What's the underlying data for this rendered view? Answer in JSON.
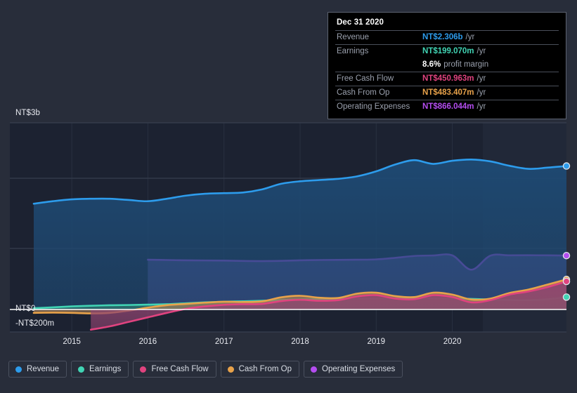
{
  "chart_data": {
    "type": "area",
    "title": "",
    "xlabel": "",
    "ylabel": "",
    "currency": "NT$",
    "grid": true,
    "legend_position": "bottom",
    "x_ticks": [
      "2015",
      "2016",
      "2017",
      "2018",
      "2019",
      "2020"
    ],
    "y_ticks": [
      "NT$3b",
      "NT$0",
      "-NT$200m"
    ],
    "ylim": [
      -200000000,
      3400000000
    ],
    "zero_line": 0,
    "series": [
      {
        "name": "Revenue",
        "color": "#2d9cec",
        "fill": "#1e4a74",
        "values": [
          1.7,
          1.74,
          1.77,
          1.78,
          1.78,
          1.76,
          1.74,
          1.78,
          1.83,
          1.86,
          1.87,
          1.88,
          1.93,
          2.02,
          2.06,
          2.08,
          2.1,
          2.14,
          2.22,
          2.33,
          2.4,
          2.34,
          2.39,
          2.41,
          2.38,
          2.31,
          2.26,
          2.28,
          2.306
        ],
        "unit": "NT$b"
      },
      {
        "name": "Earnings",
        "color": "#41d4b4",
        "fill": "#2f7f74",
        "values": [
          0.02,
          0.035,
          0.05,
          0.06,
          0.068,
          0.072,
          0.078,
          0.085,
          0.1,
          0.115,
          0.125,
          0.132,
          0.14,
          0.152,
          0.16,
          0.165,
          0.17,
          0.172,
          0.175,
          0.178,
          0.18,
          0.178,
          0.175,
          0.17,
          0.16,
          0.152,
          0.15,
          0.165,
          0.199
        ],
        "unit": "NT$b"
      },
      {
        "name": "Free Cash Flow",
        "color": "#e0437f",
        "fill": "#8e4470",
        "values": [
          null,
          null,
          null,
          -0.18,
          -0.15,
          -0.11,
          -0.07,
          -0.03,
          0.01,
          0.05,
          0.075,
          0.085,
          0.09,
          0.135,
          0.155,
          0.14,
          0.15,
          0.21,
          0.23,
          0.175,
          0.165,
          0.23,
          0.2,
          0.115,
          0.15,
          0.24,
          0.29,
          0.36,
          0.451
        ],
        "unit": "NT$b"
      },
      {
        "name": "Cash From Op",
        "color": "#e8a24a",
        "fill": "#a07a53",
        "values": [
          -0.03,
          -0.028,
          -0.03,
          -0.035,
          -0.03,
          -0.01,
          0.03,
          0.07,
          0.09,
          0.11,
          0.125,
          0.12,
          0.13,
          0.195,
          0.22,
          0.19,
          0.185,
          0.255,
          0.27,
          0.215,
          0.2,
          0.27,
          0.24,
          0.16,
          0.175,
          0.265,
          0.32,
          0.4,
          0.483
        ],
        "unit": "NT$b"
      },
      {
        "name": "Operating Expenses",
        "color": "#b44df0",
        "fill": "#564a8e",
        "values": [
          null,
          null,
          null,
          null,
          null,
          null,
          0.8,
          0.795,
          0.79,
          0.788,
          0.786,
          0.78,
          0.778,
          0.782,
          0.79,
          0.795,
          0.797,
          0.8,
          0.805,
          0.83,
          0.86,
          0.868,
          0.87,
          0.64,
          0.865,
          0.87,
          0.872,
          0.87,
          0.866
        ],
        "unit": "NT$b"
      }
    ]
  },
  "tooltip": {
    "date": "Dec 31 2020",
    "rows": [
      {
        "label": "Revenue",
        "value": "NT$2.306b",
        "suffix": "/yr",
        "color": "#2d9cec"
      },
      {
        "label": "Earnings",
        "value": "NT$199.070m",
        "suffix": "/yr",
        "color": "#41d4b4"
      },
      {
        "label": "",
        "value": "8.6%",
        "suffix": "profit margin",
        "color": "#ffffff",
        "no_rule": true
      },
      {
        "label": "Free Cash Flow",
        "value": "NT$450.963m",
        "suffix": "/yr",
        "color": "#e0437f"
      },
      {
        "label": "Cash From Op",
        "value": "NT$483.407m",
        "suffix": "/yr",
        "color": "#e8a24a"
      },
      {
        "label": "Operating Expenses",
        "value": "NT$866.044m",
        "suffix": "/yr",
        "color": "#b44df0"
      }
    ]
  },
  "axis": {
    "y_top": "NT$3b",
    "y_zero": "NT$0",
    "y_bottom": "-NT$200m",
    "x_ticks": [
      "2015",
      "2016",
      "2017",
      "2018",
      "2019",
      "2020"
    ]
  },
  "legend": {
    "items": [
      {
        "label": "Revenue",
        "color": "#2d9cec"
      },
      {
        "label": "Earnings",
        "color": "#41d4b4"
      },
      {
        "label": "Free Cash Flow",
        "color": "#e0437f"
      },
      {
        "label": "Cash From Op",
        "color": "#e8a24a"
      },
      {
        "label": "Operating Expenses",
        "color": "#b44df0"
      }
    ]
  },
  "colors": {
    "background": "#282d3a",
    "plot_background": "#1c2231",
    "plot_background_right": "#212838",
    "gridline": "#3c4455",
    "zero_line": "#ffffff",
    "tooltip_background": "#000000",
    "tooltip_border": "#5c6270"
  }
}
